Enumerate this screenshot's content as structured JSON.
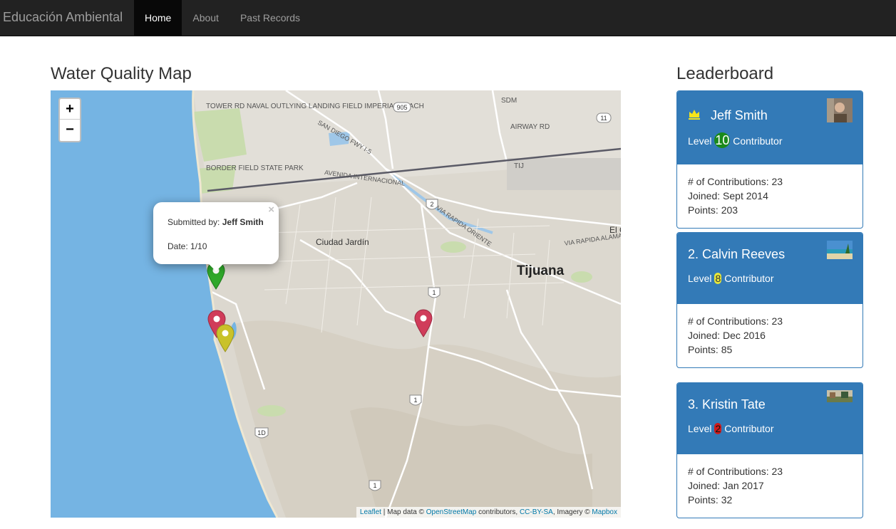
{
  "navbar": {
    "brand": "Educación Ambiental",
    "items": [
      {
        "label": "Home",
        "active": true
      },
      {
        "label": "About",
        "active": false
      },
      {
        "label": "Past Records",
        "active": false
      }
    ]
  },
  "map": {
    "title": "Water Quality Map",
    "zoom_in": "+",
    "zoom_out": "−",
    "labels": {
      "tijuana": "Tijuana",
      "ciudad_jardin": "Ciudad Jardín",
      "el": "El C",
      "naval": "Tower RD Naval Outlying Landing Field Imperial Beach",
      "border_field": "Border Field State Park",
      "sdm": "SDM",
      "airway": "Airway RD",
      "tij": "TIJ",
      "avenida": "Avenida Internacional",
      "via_rapida": "Via Rapida Oriente",
      "alamar": "Via Rapida Alamar",
      "san_diego": "San Diego Fwy I-5"
    },
    "shields": [
      "905",
      "11",
      "2",
      "1",
      "1",
      "1",
      "1D"
    ],
    "popup": {
      "submitted_label": "Submitted by:",
      "submitted_name": "Jeff Smith",
      "date_label": "Date: 1/10",
      "close": "×"
    },
    "markers": [
      {
        "color": "#2fa82a",
        "name": "green"
      },
      {
        "color": "#d03c5a",
        "name": "red"
      },
      {
        "color": "#c9c22a",
        "name": "yellow"
      },
      {
        "color": "#d03c5a",
        "name": "red"
      }
    ],
    "attribution": {
      "leaflet": "Leaflet",
      "sep1": " | Map data © ",
      "osm": "OpenStreetMap",
      "sep2": " contributors, ",
      "cc": "CC-BY-SA",
      "sep3": ", Imagery © ",
      "mapbox": "Mapbox"
    }
  },
  "leaderboard": {
    "title": "Leaderboard",
    "entries": [
      {
        "name": "Jeff Smith",
        "level_prefix": "Level",
        "level": "10",
        "level_color": "#1a8a1a",
        "level_suffix": "Contributor",
        "contributions": "# of Contributions: 23",
        "joined": "Joined: Sept 2014",
        "points": "Points: 203"
      },
      {
        "name": "2. Calvin Reeves",
        "level_prefix": "Level",
        "level": "8",
        "level_color": "#e8e83a",
        "level_suffix": "Contributor",
        "contributions": "# of Contributions: 23",
        "joined": "Joined: Dec 2016",
        "points": "Points: 85"
      },
      {
        "name": "3. Kristin Tate",
        "level_prefix": "Level",
        "level": "2",
        "level_color": "#d01a1a",
        "level_suffix": "Contributor",
        "contributions": "# of Contributions: 23",
        "joined": "Joined: Jan 2017",
        "points": "Points: 32"
      }
    ]
  },
  "colors": {
    "navbar_bg": "#222222",
    "active_bg": "#080808",
    "primary": "#337ab7",
    "ocean": "#75b4e3",
    "land": "#dcd8cf"
  }
}
